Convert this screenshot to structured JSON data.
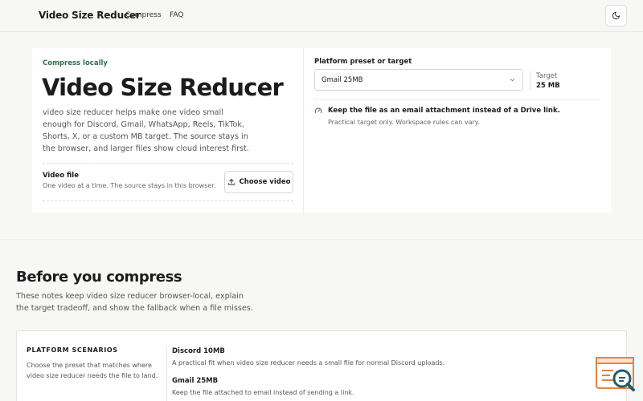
{
  "header": {
    "brand": "Video Size Reducer",
    "nav": [
      "Compress",
      "FAQ"
    ]
  },
  "hero": {
    "eyebrow": "Compress locally",
    "title": "Video Size Reducer",
    "description": "video size reducer helps make one video small enough for Discord, Gmail, WhatsApp, Reels, TikTok, Shorts, X, or a custom MB target. The source stays in the browser, and larger files show cloud interest first.",
    "video_file_label": "Video file",
    "video_file_help": "One video at a time. The source stays in this browser.",
    "choose_button": "Choose video"
  },
  "target_panel": {
    "preset_label": "Platform preset or target",
    "selected_preset": "Gmail 25MB",
    "target_label": "Target",
    "target_value": "25 MB",
    "note_title": "Keep the file as an email attachment instead of a Drive link.",
    "note_sub": "Practical target only. Workspace rules can vary."
  },
  "section": {
    "title": "Before you compress",
    "description": "These notes keep video size reducer browser-local, explain the target tradeoff, and show the fallback when a file misses."
  },
  "scenarios": {
    "heading": "PLATFORM SCENARIOS",
    "description": "Choose the preset that matches where video size reducer needs the file to land.",
    "items": [
      {
        "title": "Discord 10MB",
        "desc": "A practical fit when video size reducer needs a small file for normal Discord uploads."
      },
      {
        "title": "Gmail 25MB",
        "desc": "Keep the file attached to email instead of sending a link."
      }
    ]
  },
  "colors": {
    "accent_green": "#2f6f4a",
    "fab_orange": "#e8833a",
    "fab_teal": "#1f5f6b"
  }
}
